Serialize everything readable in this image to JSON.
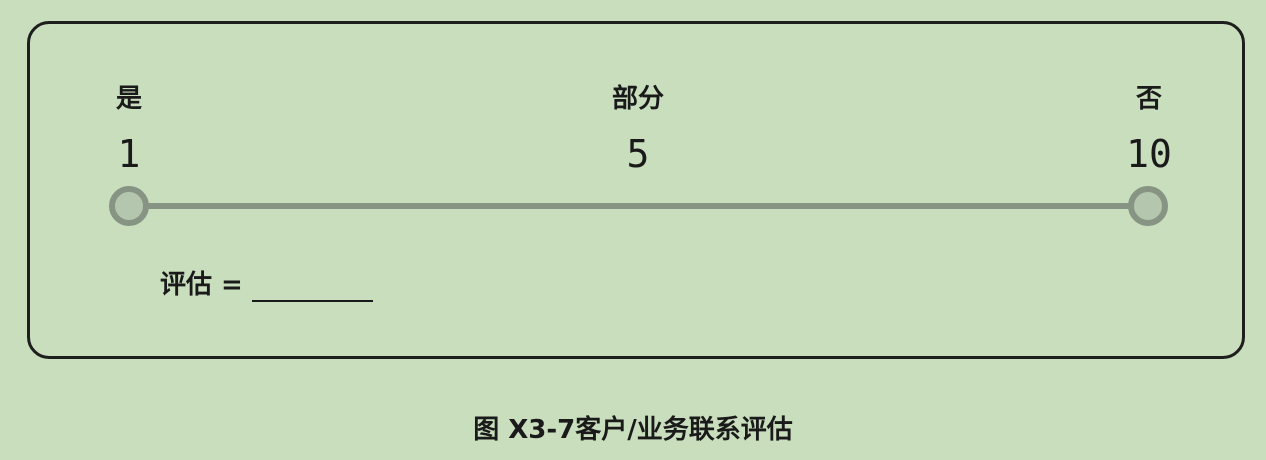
{
  "scale": {
    "points": [
      {
        "label": "是",
        "value": "1"
      },
      {
        "label": "部分",
        "value": "5"
      },
      {
        "label": "否",
        "value": "10"
      }
    ]
  },
  "rating": {
    "label": "评估 ="
  },
  "caption": "图 X3-7客户/业务联系评估",
  "colors": {
    "background": "#c8debd",
    "frame": "#1e1e1e",
    "scale_line": "#879483",
    "endpoint_fill": "#b4c6ad"
  }
}
